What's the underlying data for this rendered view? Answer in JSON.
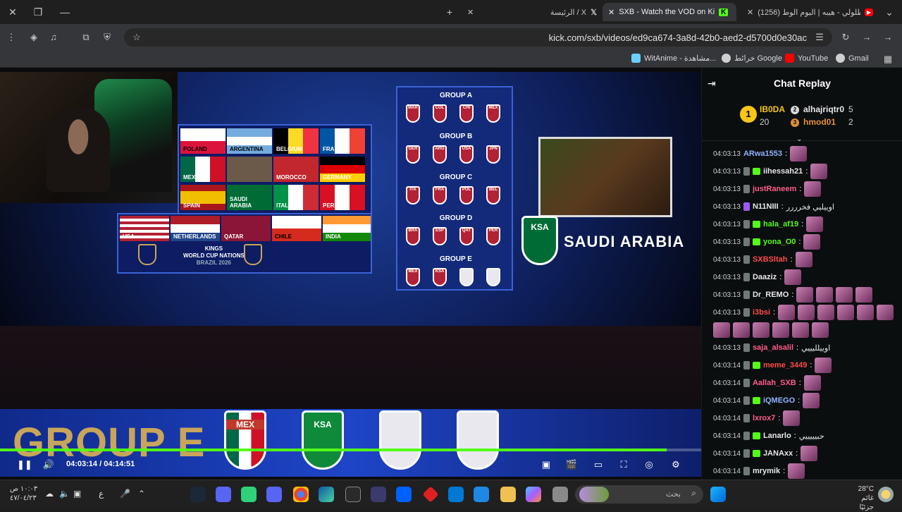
{
  "browser": {
    "tabs": [
      {
        "title": "(1256) طلولي - هيبه | اليوم الوط",
        "active": false
      },
      {
        "title": "SXB - Watch the VOD on Ki",
        "active": true
      },
      {
        "title": "الرئيسة / X",
        "active": false
      }
    ],
    "url": "kick.com/sxb/videos/ed9ca674-3a8d-42b0-aed2-d5700d0e30ac",
    "bookmarks": [
      {
        "label": "Gmail",
        "icon": "gmail-icon"
      },
      {
        "label": "YouTube",
        "icon": "youtube-icon"
      },
      {
        "label": "خرائط Google",
        "icon": "maps-icon"
      },
      {
        "label": "WitAnime - مشاهدة...",
        "icon": "witanime-icon"
      }
    ],
    "new_tab_symbol": "+",
    "close_symbol": "✕"
  },
  "video": {
    "current_time": "04:03:14",
    "duration": "04:14:51",
    "progress_fraction": 0.951,
    "overlay": {
      "group_banner": "GROUP E",
      "country_title": "SAUDI ARABIA",
      "shield_labels": [
        "MEX",
        "KSA",
        "",
        ""
      ],
      "ksa_badge": "KSA",
      "board_groups": [
        "GROUP A",
        "GROUP B",
        "GROUP C",
        "GROUP D",
        "GROUP E"
      ],
      "group_a_codes": [
        "MAR",
        "COL",
        "CHI",
        "MEX"
      ],
      "group_b_codes": [
        "GER",
        "ARG",
        "USA",
        "JPN"
      ],
      "group_c_codes": [
        "ITA",
        "FRA",
        "POL",
        "BEL"
      ],
      "group_d_codes": [
        "BRA",
        "ESP",
        "QAT",
        "PER"
      ],
      "group_e_codes": [
        "MEX",
        "KSA",
        "",
        ""
      ],
      "flag_grid": [
        "POLAND",
        "ARGENTINA",
        "BELGIUM",
        "FRANCE",
        "MEXICO",
        "",
        "MOROCCO",
        "GERMANY",
        "SPAIN",
        "SAUDI ARABIA",
        "ITALY",
        "PERU",
        "USA",
        "NETHERLANDS",
        "QATAR",
        "CHILE",
        "INDIA"
      ],
      "logo_text_1": "KINGS",
      "logo_text_2": "WORLD CUP NATIONS",
      "logo_text_3": "BRAZIL 2026"
    }
  },
  "chat": {
    "title": "Chat Replay",
    "leaderboard": [
      {
        "rank": "1",
        "name": "IB0DA",
        "count": "20",
        "color": "#f5c518"
      },
      {
        "rank": "2",
        "name": "alhajriqtr0",
        "count": "5",
        "color": "#d9d9d9"
      },
      {
        "rank": "3",
        "name": "hmod01",
        "count": "2",
        "color": "#e0903a"
      }
    ],
    "messages": [
      {
        "time": "04:03:13",
        "user": "ARwa1553",
        "color": "#8fb1ff",
        "badges": [],
        "text": "",
        "emotes": 1
      },
      {
        "time": "04:03:13",
        "user": "iihessah21",
        "color": "#e6e6e6",
        "badges": [
          "gray",
          "green"
        ],
        "text": "",
        "emotes": 1
      },
      {
        "time": "04:03:13",
        "user": "justRaneem",
        "color": "#ff5c8a",
        "badges": [
          "gray"
        ],
        "text": "",
        "emotes": 1
      },
      {
        "time": "04:03:13",
        "user": "N11NIII",
        "color": "#e6e6e6",
        "badges": [
          "purple"
        ],
        "text": "اوييليي فخرررر",
        "emotes": 0
      },
      {
        "time": "04:03:13",
        "user": "hala_af19",
        "color": "#53fc18",
        "badges": [
          "gray",
          "green"
        ],
        "text": "",
        "emotes": 1
      },
      {
        "time": "04:03:13",
        "user": "yona_O0",
        "color": "#53fc18",
        "badges": [
          "gray",
          "green"
        ],
        "text": "",
        "emotes": 1
      },
      {
        "time": "04:03:13",
        "user": "SXBSltah",
        "color": "#ff4a4a",
        "badges": [
          "gray"
        ],
        "text": "",
        "emotes": 1
      },
      {
        "time": "04:03:13",
        "user": "Daaziz",
        "color": "#e6e6e6",
        "badges": [
          "gray"
        ],
        "text": "",
        "emotes": 1
      },
      {
        "time": "04:03:13",
        "user": "Dr_REMO",
        "color": "#e6e6e6",
        "badges": [
          "gray"
        ],
        "text": "",
        "emotes": 4
      },
      {
        "time": "04:03:13",
        "user": "i3bsi",
        "color": "#ff4a4a",
        "badges": [
          "gray"
        ],
        "text": "",
        "emotes": 6
      },
      {
        "time": "",
        "user": "",
        "color": "#e6e6e6",
        "badges": [],
        "text": "",
        "emotes": 6
      },
      {
        "time": "04:03:13",
        "user": "saja_alsalil",
        "color": "#ff5c8a",
        "badges": [
          "gray"
        ],
        "text": "اوييلليييي",
        "emotes": 0
      },
      {
        "time": "04:03:14",
        "user": "meme_3449",
        "color": "#ff4a4a",
        "badges": [
          "gray",
          "green"
        ],
        "text": "",
        "emotes": 1
      },
      {
        "time": "04:03:14",
        "user": "Aallah_SXB",
        "color": "#ff5c8a",
        "badges": [
          "gray"
        ],
        "text": "",
        "emotes": 1
      },
      {
        "time": "04:03:14",
        "user": "iQMEGO",
        "color": "#8fb1ff",
        "badges": [
          "gray",
          "green"
        ],
        "text": "",
        "emotes": 1
      },
      {
        "time": "04:03:14",
        "user": "lxrox7",
        "color": "#ff5c8a",
        "badges": [
          "gray"
        ],
        "text": "",
        "emotes": 1
      },
      {
        "time": "04:03:14",
        "user": "Lanarlo",
        "color": "#e6e6e6",
        "badges": [
          "gray",
          "green"
        ],
        "text": "حبيييييي",
        "emotes": 0
      },
      {
        "time": "04:03:14",
        "user": "JANAxx",
        "color": "#e6e6e6",
        "badges": [
          "gray",
          "green"
        ],
        "text": "",
        "emotes": 1
      },
      {
        "time": "04:03:14",
        "user": "mrymik",
        "color": "#e6e6e6",
        "badges": [
          "gray"
        ],
        "text": "",
        "emotes": 1
      }
    ]
  },
  "taskbar": {
    "search_placeholder": "بحث",
    "weather_temp": "28°C",
    "weather_desc": "غائم جزئيًا",
    "clock_time": "١٠:٠٣ ص",
    "clock_date": "٤٧/٠٤/٢٣",
    "lang": "ع"
  }
}
